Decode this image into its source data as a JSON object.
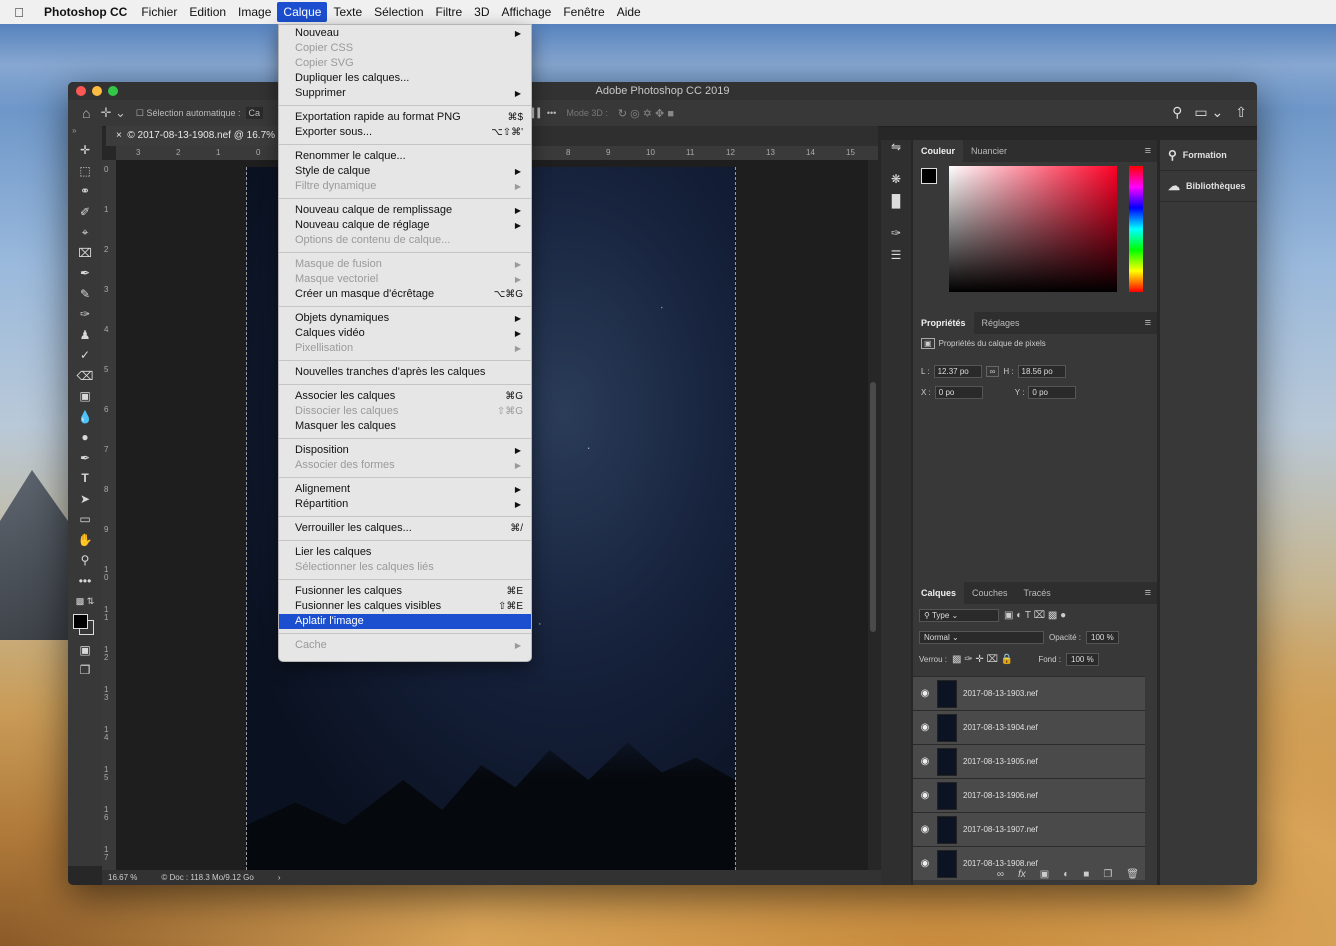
{
  "menubar": {
    "app": "Photoshop CC",
    "items": [
      "Fichier",
      "Edition",
      "Image",
      "Calque",
      "Texte",
      "Sélection",
      "Filtre",
      "3D",
      "Affichage",
      "Fenêtre",
      "Aide"
    ],
    "active": "Calque"
  },
  "window": {
    "title": "Adobe Photoshop CC 2019",
    "traffic": [
      "#fc5753",
      "#fdbc40",
      "#33c748"
    ]
  },
  "options": {
    "auto_select": "Sélection automatique :",
    "auto_value": "Ca",
    "mode3d": "Mode 3D :"
  },
  "doc": {
    "tab": "© 2017-08-13-1908.nef @ 16.7% (",
    "zoom": "16.67 %",
    "info": "Doc : 118.3 Mo/9.12 Go",
    "ruler_top": [
      "3",
      "2",
      "1",
      "0",
      "8",
      "9",
      "10",
      "11",
      "12",
      "13",
      "14",
      "15"
    ],
    "ruler_left": [
      "0",
      "1",
      "2",
      "3",
      "4",
      "5",
      "6",
      "7",
      "8",
      "9",
      "1 0",
      "1 1",
      "1 2",
      "1 3",
      "1 4",
      "1 5",
      "1 6",
      "1 7"
    ]
  },
  "menu": [
    {
      "label": "Nouveau",
      "sub": true
    },
    {
      "label": "Copier CSS",
      "dis": true
    },
    {
      "label": "Copier SVG",
      "dis": true
    },
    {
      "label": "Dupliquer les calques..."
    },
    {
      "label": "Supprimer",
      "sub": true
    },
    {
      "sep": true
    },
    {
      "label": "Exportation rapide au format PNG",
      "sc": "⌘$"
    },
    {
      "label": "Exporter sous...",
      "sc": "⌥⇧⌘'"
    },
    {
      "sep": true
    },
    {
      "label": "Renommer le calque..."
    },
    {
      "label": "Style de calque",
      "sub": true
    },
    {
      "label": "Filtre dynamique",
      "sub": true,
      "dis": true
    },
    {
      "sep": true
    },
    {
      "label": "Nouveau calque de remplissage",
      "sub": true
    },
    {
      "label": "Nouveau calque de réglage",
      "sub": true
    },
    {
      "label": "Options de contenu de calque...",
      "dis": true
    },
    {
      "sep": true
    },
    {
      "label": "Masque de fusion",
      "sub": true,
      "dis": true
    },
    {
      "label": "Masque vectoriel",
      "sub": true,
      "dis": true
    },
    {
      "label": "Créer un masque d'écrêtage",
      "sc": "⌥⌘G"
    },
    {
      "sep": true
    },
    {
      "label": "Objets dynamiques",
      "sub": true
    },
    {
      "label": "Calques vidéo",
      "sub": true
    },
    {
      "label": "Pixellisation",
      "sub": true,
      "dis": true
    },
    {
      "sep": true
    },
    {
      "label": "Nouvelles tranches d'après les calques"
    },
    {
      "sep": true
    },
    {
      "label": "Associer les calques",
      "sc": "⌘G"
    },
    {
      "label": "Dissocier les calques",
      "sc": "⇧⌘G",
      "dis": true
    },
    {
      "label": "Masquer les calques"
    },
    {
      "sep": true
    },
    {
      "label": "Disposition",
      "sub": true
    },
    {
      "label": "Associer des formes",
      "sub": true,
      "dis": true
    },
    {
      "sep": true
    },
    {
      "label": "Alignement",
      "sub": true
    },
    {
      "label": "Répartition",
      "sub": true
    },
    {
      "sep": true
    },
    {
      "label": "Verrouiller les calques...",
      "sc": "⌘/"
    },
    {
      "sep": true
    },
    {
      "label": "Lier les calques"
    },
    {
      "label": "Sélectionner les calques liés",
      "dis": true
    },
    {
      "sep": true
    },
    {
      "label": "Fusionner les calques",
      "sc": "⌘E"
    },
    {
      "label": "Fusionner les calques visibles",
      "sc": "⇧⌘E"
    },
    {
      "label": "Aplatir l'image",
      "hl": true
    },
    {
      "sep": true
    },
    {
      "label": "Cache",
      "sub": true,
      "dis": true
    }
  ],
  "color_panel": {
    "tabs": [
      "Couleur",
      "Nuancier"
    ]
  },
  "properties": {
    "tabs": [
      "Propriétés",
      "Réglages"
    ],
    "title": "Propriétés du calque de pixels",
    "w_label": "L :",
    "w": "12.37 po",
    "h_label": "H :",
    "h": "18.56 po",
    "x_label": "X :",
    "x": "0 po",
    "y_label": "Y :",
    "y": "0 po"
  },
  "layers": {
    "tabs": [
      "Calques",
      "Couches",
      "Tracés"
    ],
    "filter": "Type",
    "blend": "Normal",
    "opacity_label": "Opacité :",
    "opacity": "100 %",
    "lock_label": "Verrou :",
    "fill_label": "Fond :",
    "fill": "100 %",
    "items": [
      "2017-08-13-1903.nef",
      "2017-08-13-1904.nef",
      "2017-08-13-1905.nef",
      "2017-08-13-1906.nef",
      "2017-08-13-1907.nef",
      "2017-08-13-1908.nef"
    ]
  },
  "side": {
    "formation": "Formation",
    "bibliotheques": "Bibliothèques"
  }
}
